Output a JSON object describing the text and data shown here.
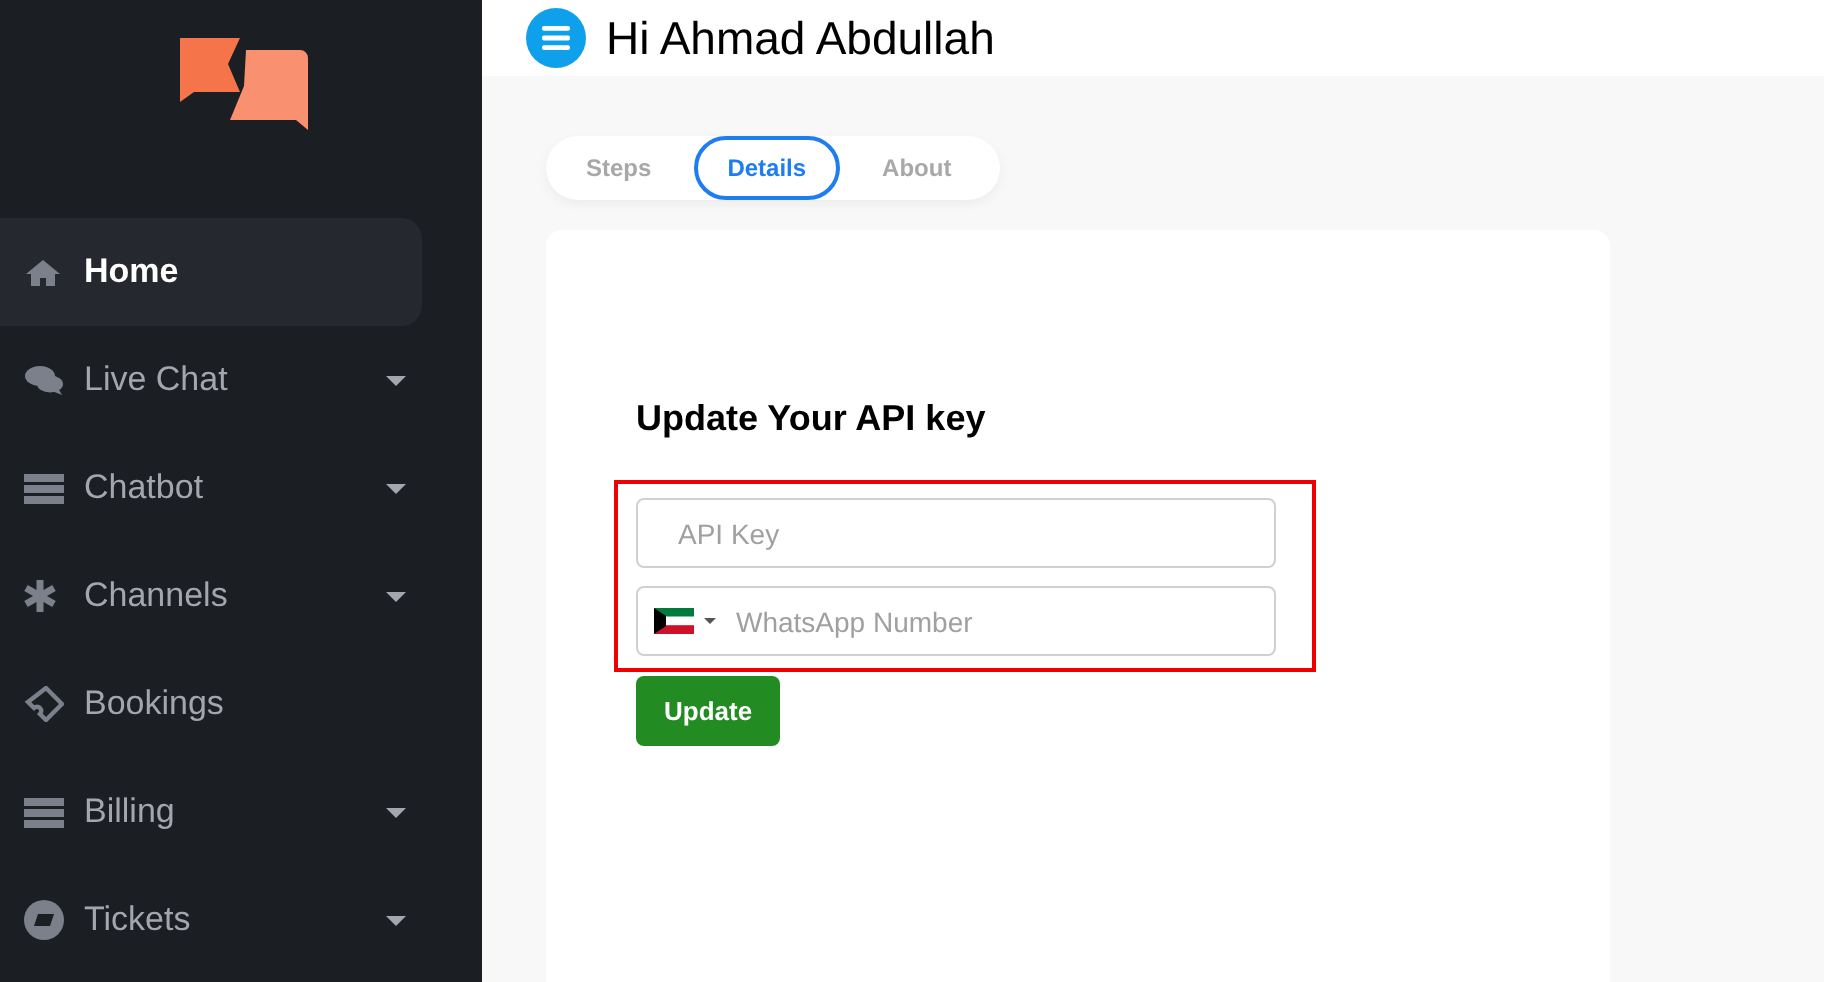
{
  "sidebar": {
    "items": [
      {
        "label": "Home",
        "selected": true,
        "expandable": false
      },
      {
        "label": "Live Chat",
        "selected": false,
        "expandable": true
      },
      {
        "label": "Chatbot",
        "selected": false,
        "expandable": true
      },
      {
        "label": "Channels",
        "selected": false,
        "expandable": true
      },
      {
        "label": "Bookings",
        "selected": false,
        "expandable": false
      },
      {
        "label": "Billing",
        "selected": false,
        "expandable": true
      },
      {
        "label": "Tickets",
        "selected": false,
        "expandable": true
      }
    ]
  },
  "header": {
    "greeting": "Hi Ahmad Abdullah"
  },
  "tabs": [
    {
      "label": "Steps",
      "selected": false
    },
    {
      "label": "Details",
      "selected": true
    },
    {
      "label": "About",
      "selected": false
    }
  ],
  "form": {
    "title": "Update Your API key",
    "api_key": {
      "placeholder": "API Key"
    },
    "phone": {
      "placeholder": "WhatsApp Number"
    },
    "button": "Update"
  }
}
